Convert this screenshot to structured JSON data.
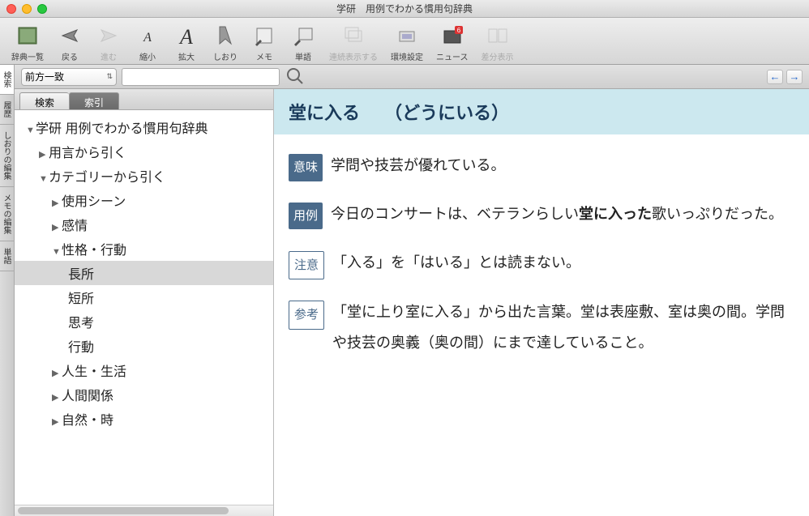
{
  "window": {
    "title": "学研　用例でわかる慣用句辞典"
  },
  "toolbar": {
    "items": [
      {
        "id": "dict-list",
        "label": "辞典一覧"
      },
      {
        "id": "back",
        "label": "戻る"
      },
      {
        "id": "forward",
        "label": "進む"
      },
      {
        "id": "shrink",
        "label": "縮小"
      },
      {
        "id": "enlarge",
        "label": "拡大"
      },
      {
        "id": "bookmark",
        "label": "しおり"
      },
      {
        "id": "memo",
        "label": "メモ"
      },
      {
        "id": "word",
        "label": "単語"
      },
      {
        "id": "continuous",
        "label": "連続表示する",
        "disabled": true
      },
      {
        "id": "prefs",
        "label": "環境設定"
      },
      {
        "id": "news",
        "label": "ニュース"
      },
      {
        "id": "diff",
        "label": "差分表示",
        "disabled": true
      }
    ]
  },
  "side_tabs": [
    {
      "label": "検索",
      "active": true
    },
    {
      "label": "履歴"
    },
    {
      "label": "しおりの編集"
    },
    {
      "label": "メモの編集"
    },
    {
      "label": "単語"
    }
  ],
  "search": {
    "mode": "前方一致",
    "value": ""
  },
  "panel_tabs": {
    "search": "検索",
    "index": "索引"
  },
  "tree": {
    "root": "学研 用例でわかる慣用句辞典",
    "yougen": "用言から引く",
    "category": "カテゴリーから引く",
    "scene": "使用シーン",
    "emotion": "感情",
    "personality": "性格・行動",
    "strength": "長所",
    "weakness": "短所",
    "thinking": "思考",
    "action": "行動",
    "life": "人生・生活",
    "relations": "人間関係",
    "nature": "自然・時"
  },
  "entry": {
    "headword": "堂に入る",
    "reading": "（どうにいる）",
    "sections": [
      {
        "tag": "意味",
        "style": "solid",
        "text_parts": [
          {
            "t": "学問や技芸が優れている。"
          }
        ]
      },
      {
        "tag": "用例",
        "style": "solid",
        "text_parts": [
          {
            "t": "今日のコンサートは、ベテランらしい"
          },
          {
            "t": "堂に入った",
            "b": true
          },
          {
            "t": "歌いっぷりだった。"
          }
        ]
      },
      {
        "tag": "注意",
        "style": "outline",
        "text_parts": [
          {
            "t": "「入る」を「はいる」とは読まない。"
          }
        ]
      },
      {
        "tag": "参考",
        "style": "outline",
        "text_parts": [
          {
            "t": "「堂に上り室に入る」から出た言葉。堂は表座敷、室は奥の間。学問や技芸の奥義（奥の間）にまで達していること。"
          }
        ]
      }
    ]
  }
}
